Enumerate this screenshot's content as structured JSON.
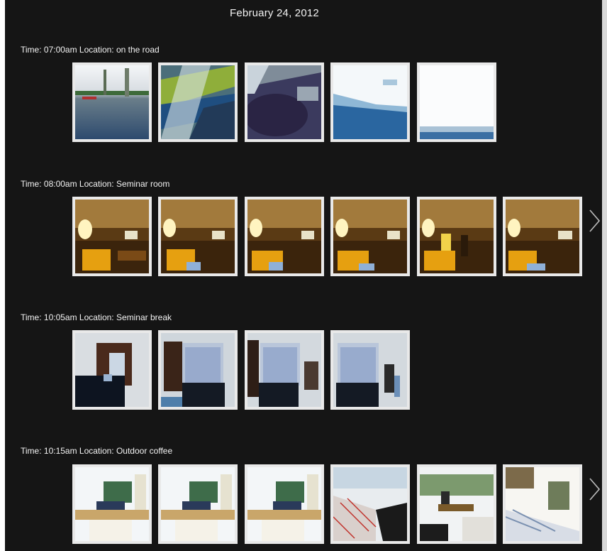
{
  "date_title": "February 24, 2012",
  "groups": [
    {
      "label": "Time: 07:00am Location: on the road",
      "photo_count": 5,
      "has_more": false
    },
    {
      "label": "Time: 08:00am Location: Seminar room",
      "photo_count": 6,
      "has_more": true
    },
    {
      "label": "Time: 10:05am Location: Seminar break",
      "photo_count": 4,
      "has_more": false
    },
    {
      "label": "Time: 10:15am Location: Outdoor coffee",
      "photo_count": 6,
      "has_more": true
    }
  ],
  "icons": {
    "next": "chevron-right-icon"
  },
  "colors": {
    "background": "#151515",
    "text": "#f2f2f2",
    "thumb_border": "#e9e9e9"
  }
}
